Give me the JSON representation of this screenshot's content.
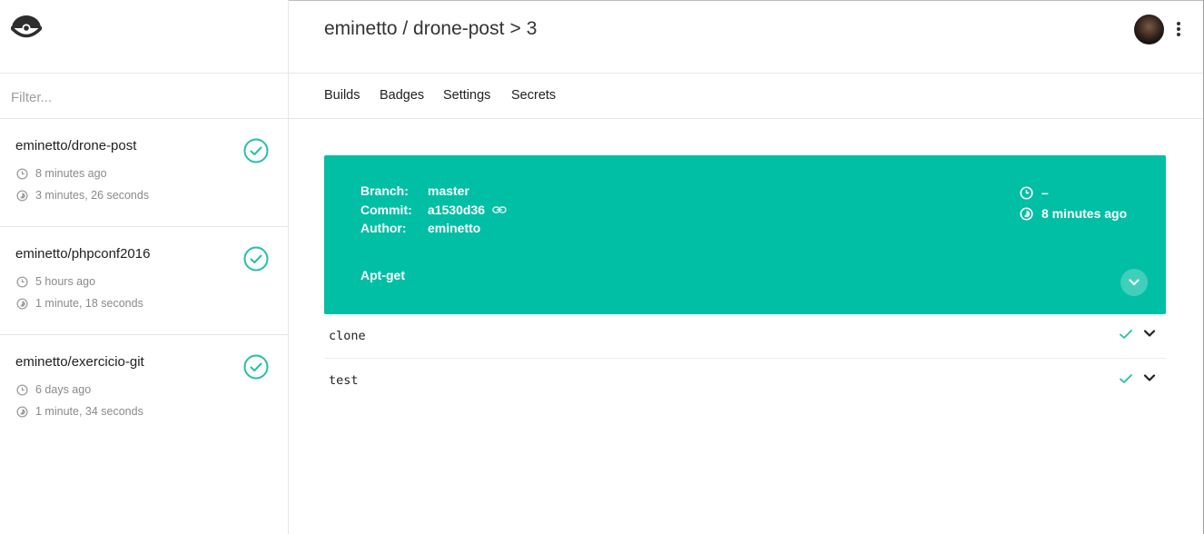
{
  "sidebar": {
    "logo_icon": "drone-logo-icon",
    "filter": {
      "placeholder": "Filter...",
      "value": ""
    },
    "repos": [
      {
        "name": "eminetto/drone-post",
        "ago": "8 minutes ago",
        "duration": "3 minutes, 26 seconds",
        "status": "success"
      },
      {
        "name": "eminetto/phpconf2016",
        "ago": "5 hours ago",
        "duration": "1 minute, 18 seconds",
        "status": "success"
      },
      {
        "name": "eminetto/exercicio-git",
        "ago": "6 days ago",
        "duration": "1 minute, 34 seconds",
        "status": "success"
      }
    ]
  },
  "header": {
    "owner_repo": "eminetto / drone-post",
    "separator": ">",
    "build_number": "3",
    "menu_icon": "more-vert-icon"
  },
  "tabs": [
    "Builds",
    "Badges",
    "Settings",
    "Secrets"
  ],
  "build": {
    "branch_label": "Branch:",
    "branch": "master",
    "commit_label": "Commit:",
    "commit": "a1530d36",
    "author_label": "Author:",
    "author": "eminetto",
    "message": "Apt-get",
    "started": "–",
    "duration": "8 minutes ago",
    "color": "#00bfa5"
  },
  "steps": [
    {
      "name": "clone",
      "status": "success"
    },
    {
      "name": "test",
      "status": "success"
    }
  ],
  "colors": {
    "accent": "#00bfa5",
    "success": "#26bfa6"
  }
}
